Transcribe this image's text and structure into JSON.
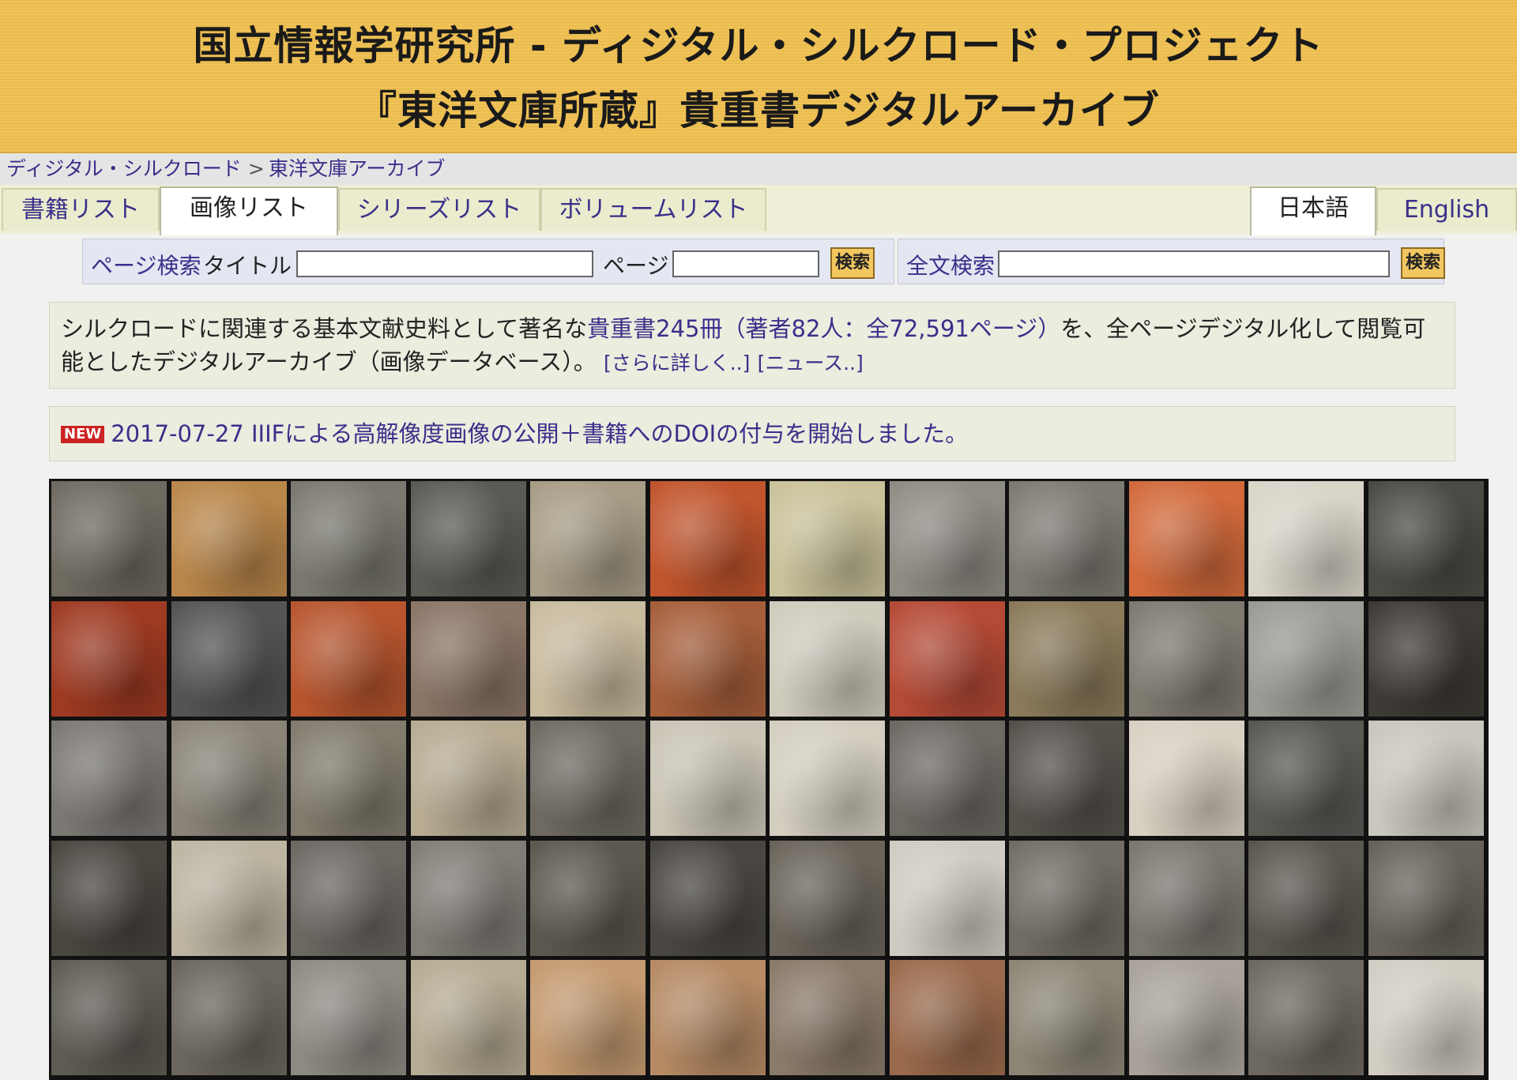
{
  "header": {
    "title_line1": "国立情報学研究所 - ディジタル・シルクロード・プロジェクト",
    "title_line2": "『東洋文庫所蔵』貴重書デジタルアーカイブ"
  },
  "breadcrumb": {
    "home": "ディジタル・シルクロード",
    "separator": ">",
    "current": "東洋文庫アーカイブ"
  },
  "tabs": [
    {
      "label": "書籍リスト"
    },
    {
      "label": "画像リスト"
    },
    {
      "label": "シリーズリスト"
    },
    {
      "label": "ボリュームリスト"
    }
  ],
  "languages": [
    {
      "label": "日本語"
    },
    {
      "label": "English"
    }
  ],
  "page_search": {
    "label": "ページ検索",
    "title_label": "タイトル",
    "title_value": "",
    "page_label": "ページ",
    "page_value": "",
    "button": "検索"
  },
  "fulltext_search": {
    "label": "全文検索",
    "value": "",
    "button": "検索"
  },
  "description": {
    "text_before": "シルクロードに関連する基本文献史料として著名な",
    "link_books": "貴重書245冊",
    "link_authors": "（著者82人：全72,591ページ）",
    "text_after": "を、全ページデジタル化して閲覧可能としたデジタルアーカイブ（画像データベース）。",
    "more_link": "[さらに詳しく..]",
    "news_link": "[ニュース..]"
  },
  "news": {
    "badge": "NEW",
    "text": "2017-07-27 IIIFによる高解像度画像の公開＋書籍へのDOIの付与を開始しました。"
  },
  "colors": {
    "header_bg": "#efc257",
    "link": "#3a2f8a",
    "tab_bg": "#eaeccd",
    "button_bg": "#f2c760",
    "badge": "#cc2222"
  },
  "thumbnails": [
    {
      "name": "expedition-group-photo",
      "tone": "#6f6a60"
    },
    {
      "name": "painted-deity-on-horse",
      "tone": "#b9864a"
    },
    {
      "name": "courtyard-photo",
      "tone": "#7a786f"
    },
    {
      "name": "standing-figure-doorway",
      "tone": "#5c5a55"
    },
    {
      "name": "ruined-tower",
      "tone": "#a79c86"
    },
    {
      "name": "mural-portrait-red",
      "tone": "#c1552d"
    },
    {
      "name": "old-map-coloured",
      "tone": "#c9c29a"
    },
    {
      "name": "stupa-desert",
      "tone": "#8f8c84"
    },
    {
      "name": "cave-cliff-facade",
      "tone": "#7d7a72"
    },
    {
      "name": "painted-lady-red",
      "tone": "#d26a3c"
    },
    {
      "name": "route-map",
      "tone": "#d9d4c8"
    },
    {
      "name": "seated-buddha-relief",
      "tone": "#4c4a44"
    },
    {
      "name": "red-textile",
      "tone": "#9e3a22"
    },
    {
      "name": "portrait-gentleman",
      "tone": "#545454"
    },
    {
      "name": "tang-figurine-horse",
      "tone": "#b7552e"
    },
    {
      "name": "mountain-range",
      "tone": "#8a7566"
    },
    {
      "name": "pottery-shards",
      "tone": "#c8bb9e"
    },
    {
      "name": "painted-banners",
      "tone": "#a65e3a"
    },
    {
      "name": "site-plan",
      "tone": "#cfcbbd"
    },
    {
      "name": "mural-deities-red",
      "tone": "#b54a36"
    },
    {
      "name": "seated-men-photo",
      "tone": "#8a7a5a"
    },
    {
      "name": "yurt-landscape",
      "tone": "#7f7a70"
    },
    {
      "name": "sand-dunes",
      "tone": "#9c9a94"
    },
    {
      "name": "seated-lama",
      "tone": "#3e3b36"
    },
    {
      "name": "snow-peaks",
      "tone": "#7b7874"
    },
    {
      "name": "potala-palace",
      "tone": "#8a8478"
    },
    {
      "name": "hill-fortress",
      "tone": "#817b6d"
    },
    {
      "name": "manuscript-fragment",
      "tone": "#b7ab92"
    },
    {
      "name": "market-street",
      "tone": "#6e6a62"
    },
    {
      "name": "metal-ewers",
      "tone": "#c9c4b5"
    },
    {
      "name": "botanical-drawing",
      "tone": "#d3cec0"
    },
    {
      "name": "inscribed-tablet",
      "tone": "#6d6a64"
    },
    {
      "name": "stone-rubbing",
      "tone": "#55524c"
    },
    {
      "name": "faint-sketch-map",
      "tone": "#d8d0c2"
    },
    {
      "name": "dense-script-page",
      "tone": "#5a5853"
    },
    {
      "name": "printed-text-page",
      "tone": "#c9c6bd"
    },
    {
      "name": "buddha-statue-cave",
      "tone": "#4a4640"
    },
    {
      "name": "striped-scroll",
      "tone": "#bdb5a2"
    },
    {
      "name": "carved-stone-rubbing",
      "tone": "#6b6862"
    },
    {
      "name": "relief-pattern",
      "tone": "#807d76"
    },
    {
      "name": "buddha-head-carving",
      "tone": "#5d584f"
    },
    {
      "name": "framed-panel",
      "tone": "#4a4743"
    },
    {
      "name": "official-portrait",
      "tone": "#6a645a"
    },
    {
      "name": "handwritten-letter",
      "tone": "#cfcbc2"
    },
    {
      "name": "cliff-dwellings",
      "tone": "#716d65"
    },
    {
      "name": "cave-mural-sketch",
      "tone": "#7a776f"
    },
    {
      "name": "row-of-figures",
      "tone": "#5a574f"
    },
    {
      "name": "buddha-niche",
      "tone": "#67635b"
    },
    {
      "name": "cave-interior",
      "tone": "#5e5b53"
    },
    {
      "name": "corridor-ruins",
      "tone": "#6a665e"
    },
    {
      "name": "valley-ruins",
      "tone": "#8d8a82"
    },
    {
      "name": "calligraphy-scroll",
      "tone": "#b6ab93"
    },
    {
      "name": "bodhisattva-statue",
      "tone": "#c49a70"
    },
    {
      "name": "gandhara-buddha",
      "tone": "#b58a64"
    },
    {
      "name": "carved-frieze",
      "tone": "#8a7a6a"
    },
    {
      "name": "seated-buddha-sepia",
      "tone": "#9a6a4c"
    },
    {
      "name": "stupa-mound",
      "tone": "#8c8676"
    },
    {
      "name": "buddha-head-stone",
      "tone": "#a8a29a"
    },
    {
      "name": "large-buddha-niche",
      "tone": "#6d6860"
    },
    {
      "name": "temple-elevation-drawing",
      "tone": "#d2cdc3"
    }
  ]
}
